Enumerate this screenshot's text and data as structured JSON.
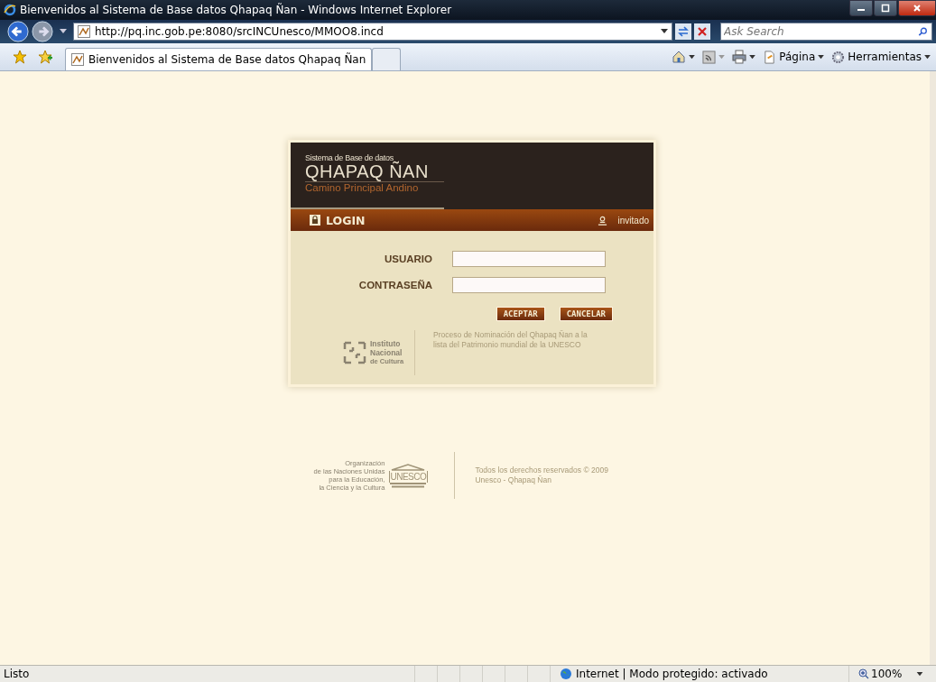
{
  "window": {
    "title": "Bienvenidos al Sistema de Base datos Qhapaq Ñan - Windows Internet Explorer"
  },
  "address_bar": {
    "url": "http://pq.inc.gob.pe:8080/srcINCUnesco/MMOO8.incd",
    "search_placeholder": "Ask Search"
  },
  "tabs": [
    {
      "label": "Bienvenidos al Sistema de Base datos Qhapaq Ñan",
      "selected": true
    }
  ],
  "command_bar": [
    {
      "kind": "home"
    },
    {
      "kind": "feeds"
    },
    {
      "kind": "print"
    },
    {
      "kind": "page",
      "label": "Página"
    },
    {
      "kind": "tools",
      "label": "Herramientas"
    }
  ],
  "login": {
    "brand_top": "Sistema de Base de datos",
    "brand_name": "QHAPAQ ÑAN",
    "brand_sub": "Camino Principal Andino",
    "header_title": "LOGIN",
    "user": "invitado",
    "fields": [
      {
        "label": "USUARIO"
      },
      {
        "label": "CONTRASEÑA"
      }
    ],
    "buttons": [
      "ACEPTAR",
      "CANCELAR"
    ],
    "inc_logo": [
      "Instituto",
      "Nacional",
      "de Cultura"
    ],
    "note": "Proceso de Nominación del Qhapaq Ñan a la lista del Patrimonio mundial de la UNESCO"
  },
  "footer": {
    "unesco_lines": [
      "Organización",
      "de las Naciones Unidas",
      "para la Educación,",
      "la Ciencia y la Cultura"
    ],
    "unesco_mark": "UNESCO",
    "copyright": [
      "Todos los derechos reservados © 2009",
      "Unesco - Qhapaq Ñan"
    ]
  },
  "status_bar": {
    "text": "Listo",
    "zone": "Internet | Modo protegido: activado",
    "zoom": "100%"
  }
}
